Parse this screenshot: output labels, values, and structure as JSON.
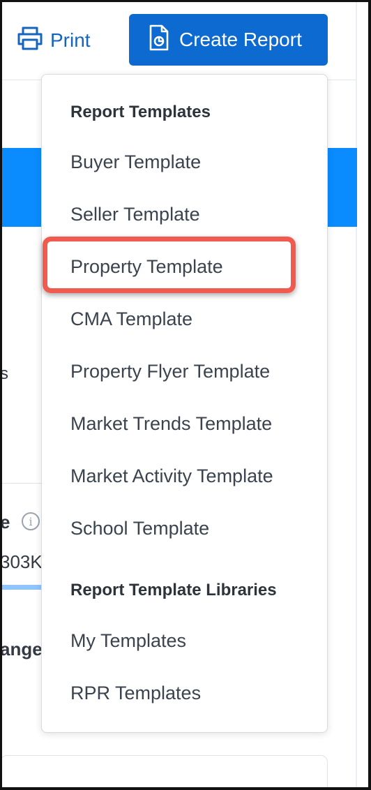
{
  "toolbar": {
    "print_label": "Print",
    "create_report_label": "Create Report",
    "accent_color": "#0d6ad1",
    "print_icon": "printer-icon",
    "report_icon": "report-document-icon"
  },
  "background": {
    "fragment_s": "s",
    "fragment_e": "e",
    "fragment_303k": "303K",
    "fragment_change": "ange",
    "info_icon": "info-icon",
    "info_glyph": "i"
  },
  "dropdown": {
    "section_templates_heading": "Report Templates",
    "templates": [
      "Buyer Template",
      "Seller Template",
      "Property Template",
      "CMA Template",
      "Property Flyer Template",
      "Market Trends Template",
      "Market Activity Template",
      "School Template"
    ],
    "section_libraries_heading": "Report Template Libraries",
    "libraries": [
      "My Templates",
      "RPR Templates"
    ],
    "highlight_color": "#f05a4f"
  }
}
